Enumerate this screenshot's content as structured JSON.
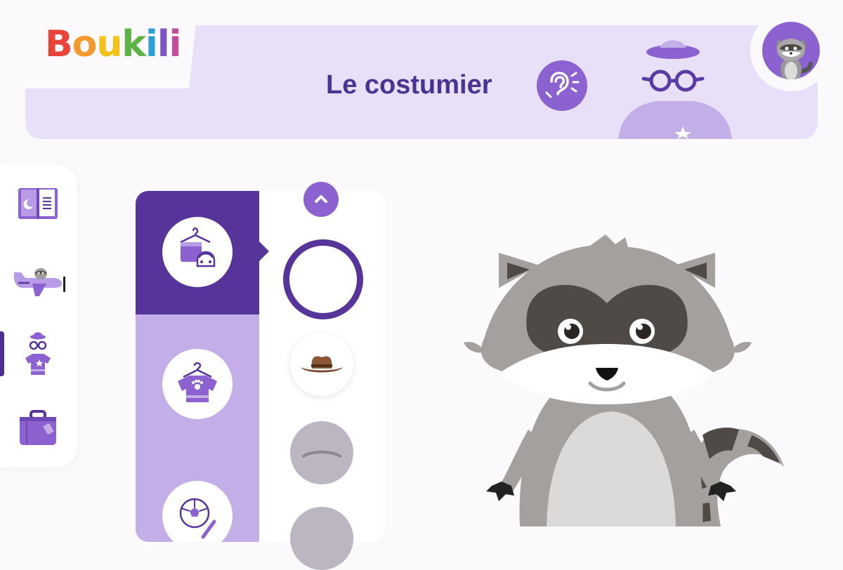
{
  "app": {
    "logo_letters": [
      "B",
      "o",
      "u",
      "k",
      "i",
      "l",
      "i"
    ],
    "title": "Le costumier"
  },
  "colors": {
    "brand_purple": "#56349a",
    "accent_purple": "#8b62cf",
    "light_purple": "#c3aee8",
    "header_bg": "#e7e0f8"
  },
  "header": {
    "listen_icon": "ear-icon",
    "character_icon": "costumier-character",
    "profile_icon": "raccoon-avatar"
  },
  "sidebar": {
    "items": [
      {
        "icon": "storybook-icon",
        "active": false
      },
      {
        "icon": "airplane-icon",
        "active": false
      },
      {
        "icon": "costumier-icon",
        "active": true
      },
      {
        "icon": "suitcase-icon",
        "active": false
      }
    ]
  },
  "wardrobe": {
    "categories": [
      {
        "icon": "headwear-clothes-icon",
        "active": true
      },
      {
        "icon": "shirt-icon",
        "active": false
      },
      {
        "icon": "sports-icon",
        "active": false
      }
    ],
    "scroll_up_icon": "chevron-up-icon",
    "items": [
      {
        "icon": "none-icon",
        "selected": true,
        "locked": false
      },
      {
        "icon": "cowboy-hat-icon",
        "selected": false,
        "locked": false
      },
      {
        "icon": "hat-locked-icon",
        "selected": false,
        "locked": true
      },
      {
        "icon": "hat-locked-icon",
        "selected": false,
        "locked": true
      }
    ]
  },
  "preview": {
    "character": "raccoon"
  }
}
